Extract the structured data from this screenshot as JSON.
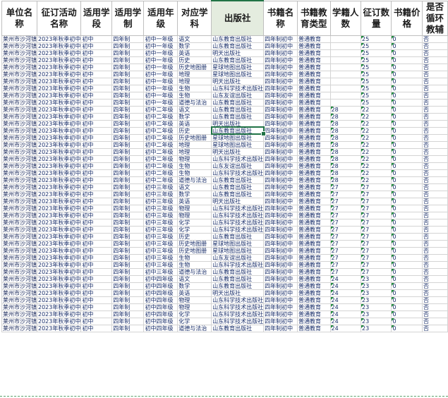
{
  "headers": [
    "单位名称",
    "征订活动名称",
    "适用学段",
    "适用学制",
    "适用年级",
    "对应学科",
    "出版社",
    "书籍名称",
    "书籍教育类型",
    "学籍人数",
    "征订数量",
    "书籍价格",
    "是否循环教辅"
  ],
  "selected_header_index": 6,
  "active_cell": {
    "row": 13,
    "col": 6
  },
  "rows": [
    [
      "莱州市沙河镇",
      "2023年秋季初中",
      "初中",
      "四年制",
      "初中一年级",
      "语文",
      "山东教育出版社",
      "四年制初中",
      "普通教育",
      "",
      "25",
      "0",
      "否"
    ],
    [
      "莱州市沙河镇",
      "2023年秋季初中",
      "初中",
      "四年制",
      "初中一年级",
      "数学",
      "山东教育出版社",
      "四年制初中",
      "普通教育",
      "",
      "25",
      "0",
      "否"
    ],
    [
      "莱州市沙河镇",
      "2023年秋季初中",
      "初中",
      "四年制",
      "初中一年级",
      "英语",
      "明天出版社",
      "四年制初中",
      "普通教育",
      "",
      "25",
      "0",
      "否"
    ],
    [
      "莱州市沙河镇",
      "2023年秋季初中",
      "初中",
      "四年制",
      "初中一年级",
      "历史",
      "山东教育出版社",
      "四年制初中",
      "普通教育",
      "",
      "25",
      "0",
      "否"
    ],
    [
      "莱州市沙河镇",
      "2023年秋季初中",
      "初中",
      "四年制",
      "初中一年级",
      "历史地图册",
      "星球地图出版社",
      "四年制初中",
      "普通教育",
      "",
      "25",
      "0",
      "否"
    ],
    [
      "莱州市沙河镇",
      "2023年秋季初中",
      "初中",
      "四年制",
      "初中一年级",
      "地理",
      "星球地图出版社",
      "四年制初中",
      "普通教育",
      "",
      "25",
      "0",
      "否"
    ],
    [
      "莱州市沙河镇",
      "2023年秋季初中",
      "初中",
      "四年制",
      "初中一年级",
      "地理",
      "明天出版社",
      "四年制初中",
      "普通教育",
      "",
      "25",
      "0",
      "否"
    ],
    [
      "莱州市沙河镇",
      "2023年秋季初中",
      "初中",
      "四年制",
      "初中一年级",
      "生物",
      "山东科学技术出版社",
      "四年制初中",
      "普通教育",
      "",
      "25",
      "0",
      "否"
    ],
    [
      "莱州市沙河镇",
      "2023年秋季初中",
      "初中",
      "四年制",
      "初中一年级",
      "生物",
      "山东友谊出版社",
      "四年制初中",
      "普通教育",
      "",
      "25",
      "0",
      "否"
    ],
    [
      "莱州市沙河镇",
      "2023年秋季初中",
      "初中",
      "四年制",
      "初中一年级",
      "道德与法治",
      "山东教育出版社",
      "四年制初中",
      "普通教育",
      "",
      "25",
      "0",
      "否"
    ],
    [
      "莱州市沙河镇",
      "2023年秋季初中",
      "初中",
      "四年制",
      "初中二年级",
      "语文",
      "山东教育出版社",
      "四年制初中",
      "普通教育",
      "28",
      "22",
      "0",
      "否"
    ],
    [
      "莱州市沙河镇",
      "2023年秋季初中",
      "初中",
      "四年制",
      "初中二年级",
      "数学",
      "山东教育出版社",
      "四年制初中",
      "普通教育",
      "28",
      "22",
      "0",
      "否"
    ],
    [
      "莱州市沙河镇",
      "2023年秋季初中",
      "初中",
      "四年制",
      "初中二年级",
      "英语",
      "明天出版社",
      "四年制初中",
      "普通教育",
      "28",
      "22",
      "0",
      "否"
    ],
    [
      "莱州市沙河镇",
      "2023年秋季初中",
      "初中",
      "四年制",
      "初中二年级",
      "历史",
      "山东教育出版社",
      "四年制初中",
      "普通教育",
      "28",
      "22",
      "0",
      "否"
    ],
    [
      "莱州市沙河镇",
      "2023年秋季初中",
      "初中",
      "四年制",
      "初中二年级",
      "历史地图册",
      "星球地图出版社",
      "四年制初中",
      "普通教育",
      "28",
      "22",
      "0",
      "否"
    ],
    [
      "莱州市沙河镇",
      "2023年秋季初中",
      "初中",
      "四年制",
      "初中二年级",
      "地理",
      "星球地图出版社",
      "四年制初中",
      "普通教育",
      "28",
      "22",
      "0",
      "否"
    ],
    [
      "莱州市沙河镇",
      "2023年秋季初中",
      "初中",
      "四年制",
      "初中二年级",
      "地理",
      "明天出版社",
      "四年制初中",
      "普通教育",
      "28",
      "22",
      "0",
      "否"
    ],
    [
      "莱州市沙河镇",
      "2023年秋季初中",
      "初中",
      "四年制",
      "初中二年级",
      "物理",
      "山东科学技术出版社",
      "四年制初中",
      "普通教育",
      "28",
      "22",
      "0",
      "否"
    ],
    [
      "莱州市沙河镇",
      "2023年秋季初中",
      "初中",
      "四年制",
      "初中二年级",
      "生物",
      "山东友谊出版社",
      "四年制初中",
      "普通教育",
      "28",
      "22",
      "0",
      "否"
    ],
    [
      "莱州市沙河镇",
      "2023年秋季初中",
      "初中",
      "四年制",
      "初中二年级",
      "生物",
      "山东科学技术出版社",
      "四年制初中",
      "普通教育",
      "28",
      "22",
      "0",
      "否"
    ],
    [
      "莱州市沙河镇",
      "2023年秋季初中",
      "初中",
      "四年制",
      "初中二年级",
      "道德与法治",
      "山东教育出版社",
      "四年制初中",
      "普通教育",
      "28",
      "22",
      "0",
      "否"
    ],
    [
      "莱州市沙河镇",
      "2023年秋季初中",
      "初中",
      "四年制",
      "初中三年级",
      "语文",
      "山东教育出版社",
      "四年制初中",
      "普通教育",
      "27",
      "27",
      "0",
      "否"
    ],
    [
      "莱州市沙河镇",
      "2023年秋季初中",
      "初中",
      "四年制",
      "初中三年级",
      "数学",
      "山东教育出版社",
      "四年制初中",
      "普通教育",
      "27",
      "27",
      "0",
      "否"
    ],
    [
      "莱州市沙河镇",
      "2023年秋季初中",
      "初中",
      "四年制",
      "初中三年级",
      "英语",
      "明天出版社",
      "四年制初中",
      "普通教育",
      "27",
      "27",
      "0",
      "否"
    ],
    [
      "莱州市沙河镇",
      "2023年秋季初中",
      "初中",
      "四年制",
      "初中三年级",
      "物理",
      "山东科学技术出版社",
      "四年制初中",
      "普通教育",
      "27",
      "27",
      "0",
      "否"
    ],
    [
      "莱州市沙河镇",
      "2023年秋季初中",
      "初中",
      "四年制",
      "初中三年级",
      "物理",
      "山东科学技术出版社",
      "四年制初中",
      "普通教育",
      "27",
      "27",
      "0",
      "否"
    ],
    [
      "莱州市沙河镇",
      "2023年秋季初中",
      "初中",
      "四年制",
      "初中三年级",
      "化学",
      "山东科学技术出版社",
      "四年制初中",
      "普通教育",
      "27",
      "27",
      "0",
      "否"
    ],
    [
      "莱州市沙河镇",
      "2023年秋季初中",
      "初中",
      "四年制",
      "初中三年级",
      "化学",
      "山东科学技术出版社",
      "四年制初中",
      "普通教育",
      "27",
      "27",
      "0",
      "否"
    ],
    [
      "莱州市沙河镇",
      "2023年秋季初中",
      "初中",
      "四年制",
      "初中三年级",
      "历史",
      "山东教育出版社",
      "四年制初中",
      "普通教育",
      "27",
      "27",
      "0",
      "否"
    ],
    [
      "莱州市沙河镇",
      "2023年秋季初中",
      "初中",
      "四年制",
      "初中三年级",
      "历史地图册",
      "星球地图出版社",
      "四年制初中",
      "普通教育",
      "27",
      "27",
      "0",
      "否"
    ],
    [
      "莱州市沙河镇",
      "2023年秋季初中",
      "初中",
      "四年制",
      "初中三年级",
      "历史地图册",
      "星球地图出版社",
      "四年制初中",
      "普通教育",
      "27",
      "27",
      "0",
      "否"
    ],
    [
      "莱州市沙河镇",
      "2023年秋季初中",
      "初中",
      "四年制",
      "初中三年级",
      "生物",
      "山东友谊出版社",
      "四年制初中",
      "普通教育",
      "27",
      "27",
      "0",
      "否"
    ],
    [
      "莱州市沙河镇",
      "2023年秋季初中",
      "初中",
      "四年制",
      "初中三年级",
      "生物",
      "山东科学技术出版社",
      "四年制初中",
      "普通教育",
      "27",
      "27",
      "0",
      "否"
    ],
    [
      "莱州市沙河镇",
      "2023年秋季初中",
      "初中",
      "四年制",
      "初中三年级",
      "道德与法治",
      "山东教育出版社",
      "四年制初中",
      "普通教育",
      "27",
      "27",
      "0",
      "否"
    ],
    [
      "莱州市沙河镇",
      "2023年秋季初中",
      "初中",
      "四年制",
      "初中四年级",
      "语文",
      "山东教育出版社",
      "四年制初中",
      "普通教育",
      "24",
      "23",
      "0",
      "否"
    ],
    [
      "莱州市沙河镇",
      "2023年秋季初中",
      "初中",
      "四年制",
      "初中四年级",
      "数学",
      "山东教育出版社",
      "四年制初中",
      "普通教育",
      "24",
      "23",
      "0",
      "否"
    ],
    [
      "莱州市沙河镇",
      "2023年秋季初中",
      "初中",
      "四年制",
      "初中四年级",
      "英语",
      "明天出版社",
      "四年制初中",
      "普通教育",
      "24",
      "23",
      "0",
      "否"
    ],
    [
      "莱州市沙河镇",
      "2023年秋季初中",
      "初中",
      "四年制",
      "初中四年级",
      "物理",
      "山东科学技术出版社",
      "四年制初中",
      "普通教育",
      "24",
      "23",
      "0",
      "否"
    ],
    [
      "莱州市沙河镇",
      "2023年秋季初中",
      "初中",
      "四年制",
      "初中四年级",
      "物理",
      "山东科学技术出版社",
      "四年制初中",
      "普通教育",
      "24",
      "23",
      "0",
      "否"
    ],
    [
      "莱州市沙河镇",
      "2023年秋季初中",
      "初中",
      "四年制",
      "初中四年级",
      "化学",
      "山东科学技术出版社",
      "四年制初中",
      "普通教育",
      "24",
      "23",
      "0",
      "否"
    ],
    [
      "莱州市沙河镇",
      "2023年秋季初中",
      "初中",
      "四年制",
      "初中四年级",
      "化学",
      "山东科学技术出版社",
      "四年制初中",
      "普通教育",
      "24",
      "23",
      "0",
      "否"
    ],
    [
      "莱州市沙河镇",
      "2023年秋季初中",
      "初中",
      "四年制",
      "初中四年级",
      "道德与法治",
      "山东教育出版社",
      "四年制初中",
      "普通教育",
      "24",
      "23",
      "0",
      "否"
    ]
  ],
  "colors": {
    "grid": "#d4d4d4",
    "selection": "#217346",
    "error_indicator": "#1e8a3a",
    "cell_text": "#1a2f6a"
  }
}
